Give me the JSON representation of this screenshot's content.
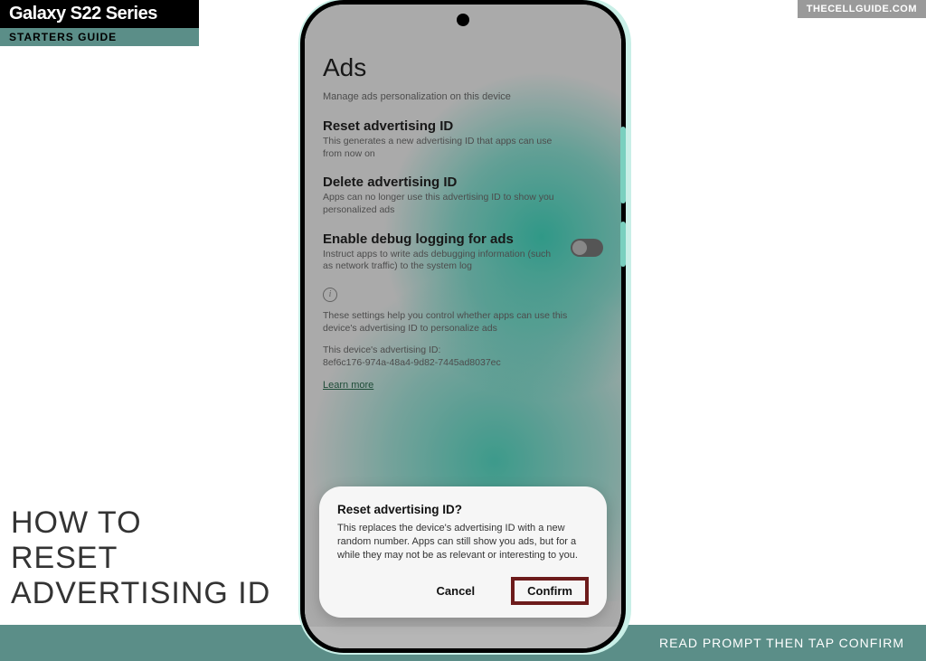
{
  "header": {
    "series": "Galaxy S22 Series",
    "guide": "STARTERS GUIDE",
    "site": "THECELLGUIDE.COM"
  },
  "big_title": {
    "line1": "HOW TO",
    "line2": "RESET",
    "line3": "ADVERTISING ID"
  },
  "bottom_bar": "READ PROMPT THEN TAP CONFIRM",
  "screen": {
    "title": "Ads",
    "subtitle": "Manage ads personalization on this device",
    "rows": {
      "reset": {
        "title": "Reset advertising ID",
        "sub": "This generates a new advertising ID that apps can use from now on"
      },
      "delete": {
        "title": "Delete advertising ID",
        "sub": "Apps can no longer use this advertising ID to show you personalized ads"
      },
      "debug": {
        "title": "Enable debug logging for ads",
        "sub": "Instruct apps to write ads debugging information (such as network traffic) to the system log"
      }
    },
    "info": {
      "p1": "These settings help you control whether apps can use this device's advertising ID to personalize ads",
      "p2a": "This device's advertising ID:",
      "p2b": "8ef6c176-974a-48a4-9d82-7445ad8037ec",
      "learn": "Learn more"
    }
  },
  "modal": {
    "title": "Reset advertising ID?",
    "body": "This replaces the device's advertising ID with a new random number. Apps can still show you ads, but for a while they may not be as relevant or interesting to you.",
    "cancel": "Cancel",
    "confirm": "Confirm"
  }
}
